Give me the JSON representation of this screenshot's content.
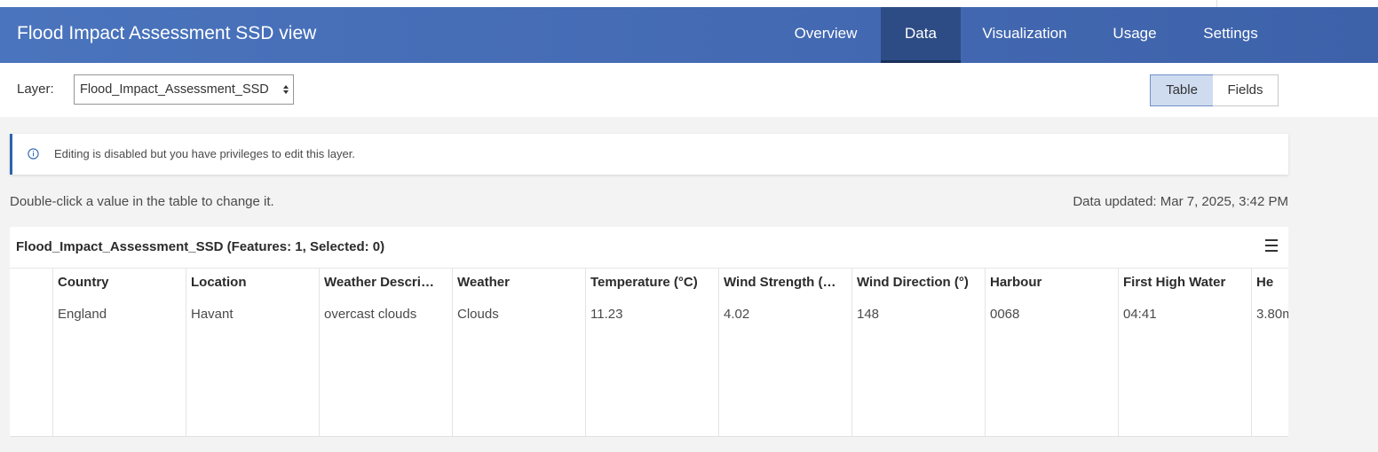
{
  "header": {
    "title": "Flood Impact Assessment SSD view",
    "tabs": [
      {
        "label": "Overview"
      },
      {
        "label": "Data"
      },
      {
        "label": "Visualization"
      },
      {
        "label": "Usage"
      },
      {
        "label": "Settings"
      }
    ],
    "active_tab": "Data"
  },
  "layerbar": {
    "label": "Layer:",
    "selected": "Flood_Impact_Assessment_SSD",
    "view_table": "Table",
    "view_fields": "Fields"
  },
  "notice": {
    "icon": "info-icon",
    "text": "Editing is disabled but you have privileges to edit this layer."
  },
  "hint": "Double-click a value in the table to change it.",
  "updated": "Data updated: Mar 7, 2025, 3:42 PM",
  "table": {
    "title": "Flood_Impact_Assessment_SSD (Features: 1, Selected: 0)",
    "menu_icon": "hamburger-menu-icon",
    "columns": [
      "Country",
      "Location",
      "Weather Descri…",
      "Weather",
      "Temperature (°C)",
      "Wind Strength (…",
      "Wind Direction (°)",
      "Harbour",
      "First High Water",
      "He"
    ],
    "rows": [
      [
        "England",
        "Havant",
        "overcast clouds",
        "Clouds",
        "11.23",
        "4.02",
        "148",
        "0068",
        "04:41",
        "3.80m"
      ]
    ]
  },
  "colors": {
    "header_bg": "#4369b2",
    "active_tab_bg": "#2d4c85",
    "accent": "#2c64b0",
    "segment_active_bg": "#cfdcf0"
  }
}
